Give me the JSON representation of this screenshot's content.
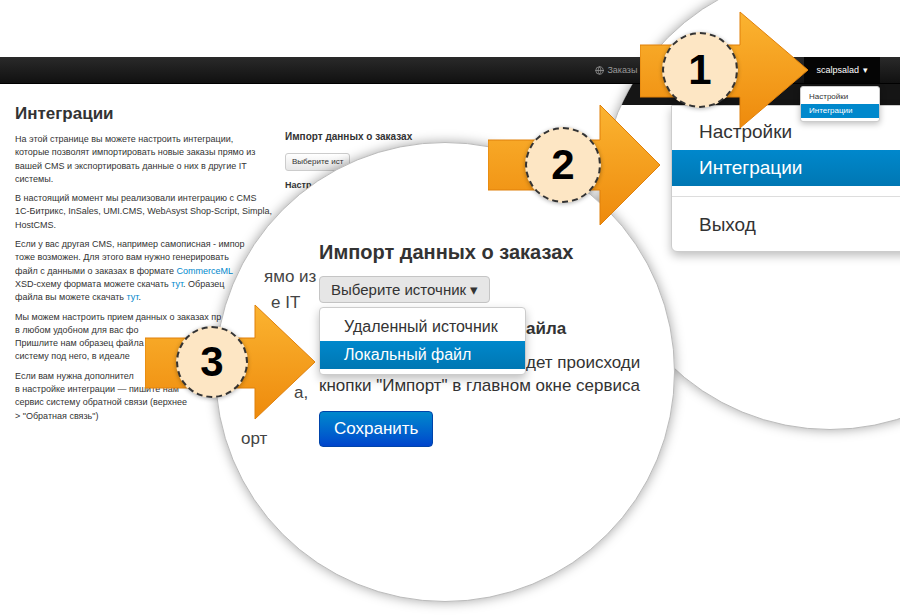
{
  "navbar": {
    "orders_link": "Заказы",
    "user_menu": {
      "label": "scalpsalad",
      "caret": "▾",
      "expanded": true,
      "items": [
        {
          "label": "Настройки",
          "selected": false
        },
        {
          "label": "Интеграции",
          "selected": true
        }
      ]
    }
  },
  "page": {
    "title": "Интеграции",
    "paragraphs": [
      [
        [
          {
            "text": "На этой странице вы можете настроить интеграции,",
            "link": false
          }
        ],
        [
          {
            "text": "которые позволят импортировать новые заказы прямо из",
            "link": false
          }
        ],
        [
          {
            "text": "вашей CMS и экспортировать данные о них в другие IT",
            "link": false
          }
        ],
        [
          {
            "text": "системы.",
            "link": false
          }
        ]
      ],
      [
        [
          {
            "text": "В настоящий момент мы реализовали интеграцию с CMS",
            "link": false
          }
        ],
        [
          {
            "text": "1С-Битрикс, InSales, UMI.CMS, WebAsyst Shop-Script, Simpla,",
            "link": false
          }
        ],
        [
          {
            "text": "HostCMS.",
            "link": false
          }
        ]
      ],
      [
        [
          {
            "text": "Если у вас другая CMS, например самописная - импор",
            "link": false
          }
        ],
        [
          {
            "text": "тоже возможен. Для этого вам нужно генерировать",
            "link": false
          }
        ],
        [
          {
            "text": "файл с данными о заказах в формате ",
            "link": false
          },
          {
            "text": "CommerceML",
            "link": true
          }
        ],
        [
          {
            "text": "XSD-схему формата можете скачать ",
            "link": false
          },
          {
            "text": "тут",
            "link": true
          },
          {
            "text": ". Образец",
            "link": false
          }
        ],
        [
          {
            "text": "файла вы можете скачать ",
            "link": false
          },
          {
            "text": "тут",
            "link": true
          },
          {
            "text": ".",
            "link": false
          }
        ]
      ],
      [
        [
          {
            "text": "Мы можем настроить прием данных о заказах пр",
            "link": false
          }
        ],
        [
          {
            "text": "в любом удобном для вас фо",
            "link": false
          }
        ],
        [
          {
            "text": "Пришлите нам образец файла",
            "link": false
          }
        ],
        [
          {
            "text": "систему под него, в идеале",
            "link": false
          }
        ]
      ],
      [
        [
          {
            "text": "Если вам нужна дополнител",
            "link": false
          }
        ],
        [
          {
            "text": "в настройке интеграции — пишите нам",
            "link": false
          }
        ],
        [
          {
            "text": "сервис систему обратной связи (верхнее",
            "link": false
          }
        ],
        [
          {
            "text": "> \"Обратная связь\")",
            "link": false
          }
        ]
      ]
    ]
  },
  "import_panel": {
    "title": "Импорт данных о заказах",
    "select_button": "Выберите ист",
    "subheading": "Настр"
  },
  "zoom_import": {
    "background_fragments": [
      "ямо из",
      "е IT",
      "а,",
      "орт"
    ],
    "title": "Импорт данных о заказах",
    "select": {
      "label": "Выберите источник",
      "caret": "▾",
      "expanded": true,
      "options": [
        {
          "label": "Удаленный источник",
          "selected": false
        },
        {
          "label": "Локальный файл",
          "selected": true
        }
      ]
    },
    "section_heading": "айла",
    "text_lines": [
      "дет происходи",
      "кнопки \"Импорт\" в главном окне сервиса"
    ],
    "save_button": "Сохранить"
  },
  "zoom_menu": {
    "items": [
      {
        "kind": "item",
        "label": "Настройки",
        "selected": false
      },
      {
        "kind": "item",
        "label": "Интеграции",
        "selected": true
      },
      {
        "kind": "divider",
        "selected": false
      },
      {
        "kind": "item",
        "label": "Выход",
        "selected": false
      }
    ]
  },
  "steps": [
    {
      "number": "1"
    },
    {
      "number": "2"
    },
    {
      "number": "3"
    }
  ]
}
